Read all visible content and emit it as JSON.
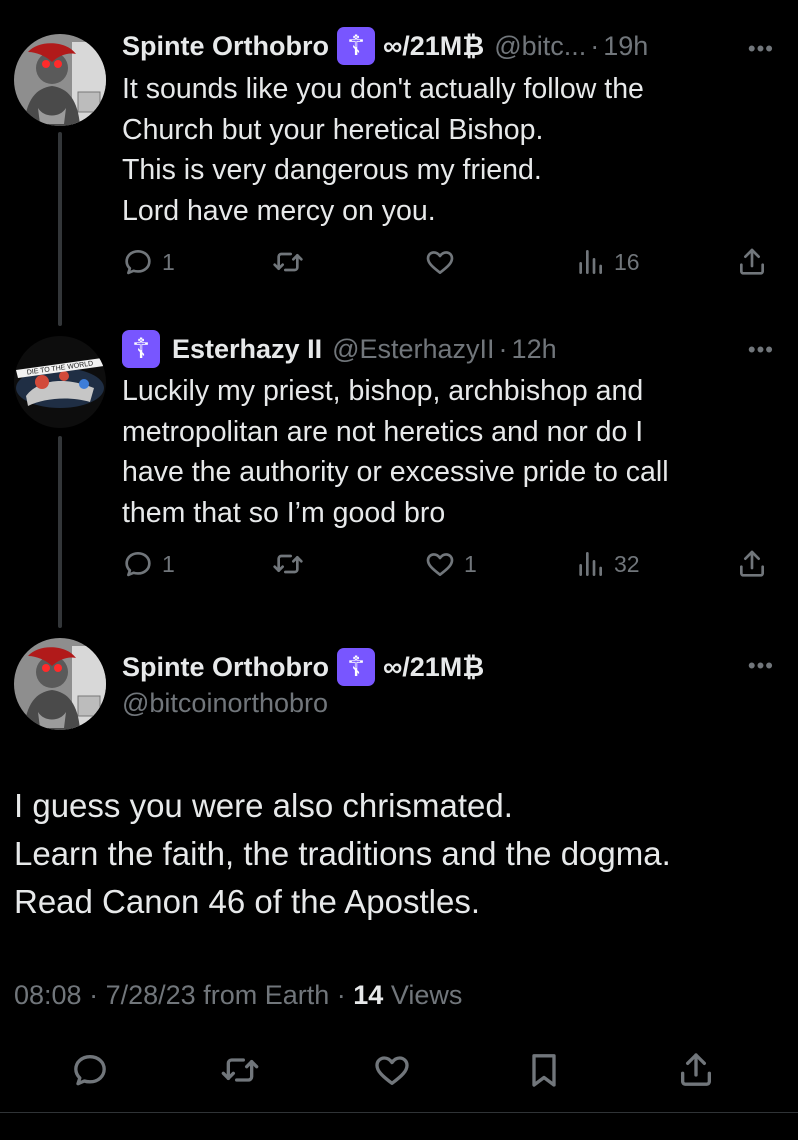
{
  "replies": [
    {
      "display_name": "Spinte Orthobro",
      "badge": "☦",
      "name_suffix": "∞/21M₿",
      "handle": "@bitc...",
      "time": "19h",
      "text": "It sounds like you don't actually follow the\nChurch but your heretical Bishop.\nThis is very dangerous my friend.\nLord have mercy on you.",
      "replies_count": "1",
      "likes_count": "",
      "views_count": "16"
    },
    {
      "display_name": "Esterhazy II",
      "badge": "☦",
      "name_suffix": "",
      "handle": "@EsterhazyII",
      "time": "12h",
      "avatar_caption": "DIE TO THE WORLD",
      "text": "Luckily my priest, bishop, archbishop and\nmetropolitan are not heretics and nor do I\nhave the authority or excessive pride to call\nthem that so I’m good bro",
      "replies_count": "1",
      "likes_count": "1",
      "views_count": "32"
    }
  ],
  "main_tweet": {
    "display_name": "Spinte Orthobro",
    "badge": "☦",
    "name_suffix": "∞/21M₿",
    "handle": "@bitcoinorthobro",
    "text": "I guess you were also chrismated.\nLearn the faith, the traditions and the dogma.\nRead Canon 46 of the Apostles.",
    "time": "08:08",
    "date": "7/28/23",
    "source": "from Earth",
    "views_count": "14",
    "views_label": "Views"
  },
  "colors": {
    "badge": "#7856ff",
    "muted": "#71767b",
    "text": "#e7e9ea",
    "background": "#000000"
  },
  "icons": [
    "reply-icon",
    "retweet-icon",
    "like-icon",
    "views-icon",
    "share-icon",
    "bookmark-icon",
    "more-icon"
  ]
}
